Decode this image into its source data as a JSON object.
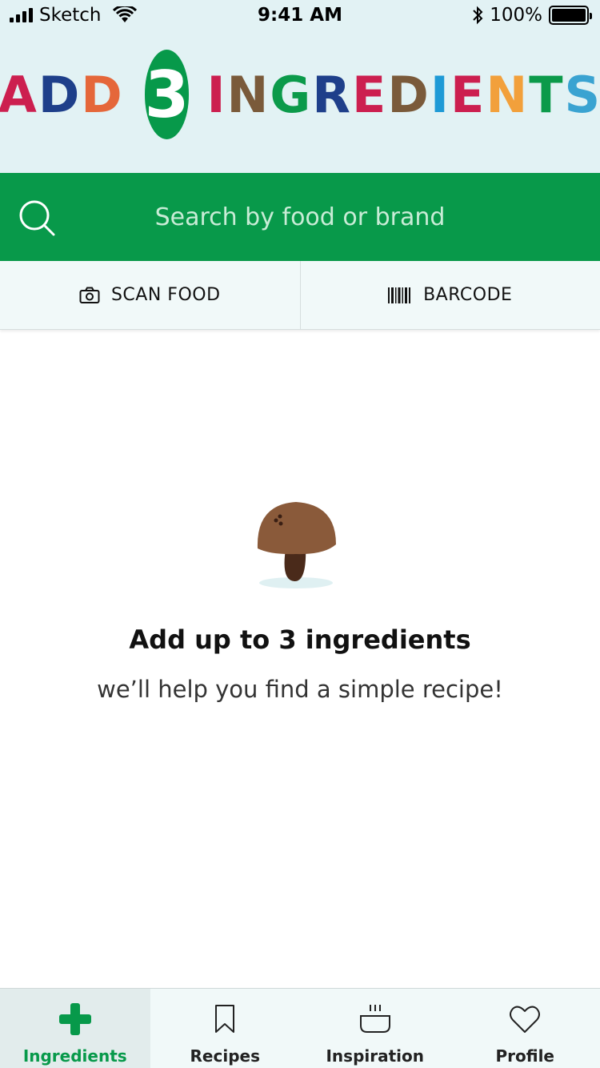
{
  "status_bar": {
    "carrier": "Sketch",
    "time": "9:41 AM",
    "battery": "100%"
  },
  "header": {
    "title_prefix": "ADD",
    "title_number": "3",
    "title_suffix": "INGREDIENTS",
    "title_colors": {
      "A": "#cc1f4f",
      "D1": "#1e3f8a",
      "D2": "#e5673a",
      "I": "#cc1f4f",
      "N": "#7a5a3a",
      "G": "#0b9a4a",
      "R": "#1e3f8a",
      "E": "#cc1f4f",
      "D": "#7a5a3a",
      "I2": "#1e9ad6",
      "E2": "#cc1f4f",
      "N2": "#f2a03b",
      "T": "#0b9a4a",
      "S": "#3aa3d1"
    },
    "background_color": "#e2f2f4",
    "badge_color": "#07994a"
  },
  "search": {
    "placeholder": "Search by food or brand",
    "icon": "search-icon",
    "background_color": "#08994a"
  },
  "actions": [
    {
      "label": "SCAN FOOD",
      "icon": "camera-icon"
    },
    {
      "label": "BARCODE",
      "icon": "barcode-icon"
    }
  ],
  "empty_state": {
    "illustration": "mushroom-icon",
    "title": "Add up to 3 ingredients",
    "subtitle": "we’ll help you find a simple recipe!"
  },
  "tabs": [
    {
      "label": "Ingredients",
      "icon": "plus-icon",
      "active": true
    },
    {
      "label": "Recipes",
      "icon": "bookmark-icon",
      "active": false
    },
    {
      "label": "Inspiration",
      "icon": "pot-icon",
      "active": false
    },
    {
      "label": "Profile",
      "icon": "heart-icon",
      "active": false
    }
  ],
  "accent_color": "#07994a"
}
